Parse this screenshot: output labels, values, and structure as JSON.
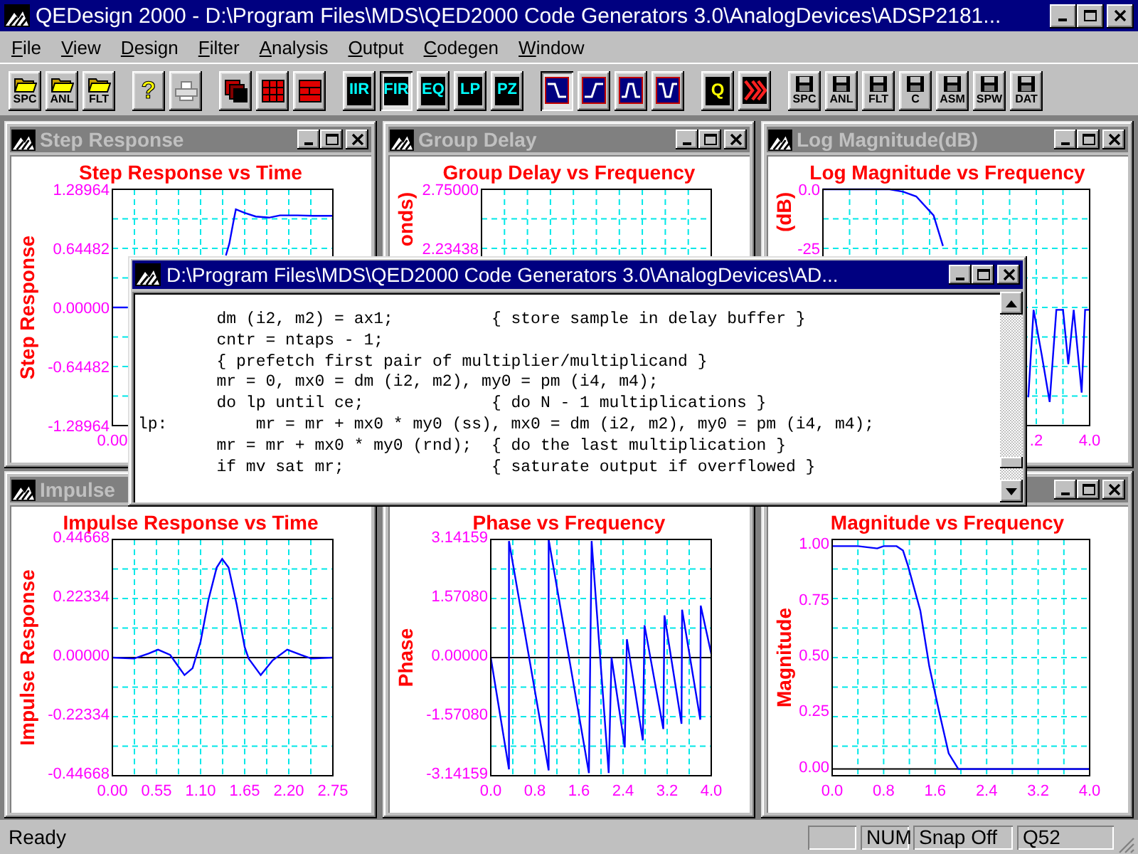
{
  "window": {
    "title": "QEDesign 2000 - D:\\Program Files\\MDS\\QED2000 Code Generators 3.0\\AnalogDevices\\ADSP2181..."
  },
  "menu": [
    "File",
    "View",
    "Design",
    "Filter",
    "Analysis",
    "Output",
    "Codegen",
    "Window"
  ],
  "toolbar": [
    [
      {
        "kind": "open",
        "label": "SPC"
      },
      {
        "kind": "open",
        "label": "ANL"
      },
      {
        "kind": "open",
        "label": "FLT"
      }
    ],
    [
      {
        "kind": "help",
        "label": "?"
      },
      {
        "kind": "print",
        "disabled": true
      }
    ],
    [
      {
        "kind": "cascade"
      },
      {
        "kind": "grid"
      },
      {
        "kind": "rows"
      }
    ],
    [
      {
        "kind": "mode",
        "label": "IIR",
        "selected": false
      },
      {
        "kind": "mode",
        "label": "FIR",
        "selected": true
      },
      {
        "kind": "mode",
        "label": "EQ",
        "selected": false
      },
      {
        "kind": "mode",
        "label": "LP",
        "selected": false
      },
      {
        "kind": "mode",
        "label": "PZ",
        "selected": false
      }
    ],
    [
      {
        "kind": "lowpass",
        "selected": true
      },
      {
        "kind": "highpass",
        "selected": false
      },
      {
        "kind": "bandpass",
        "selected": false
      },
      {
        "kind": "bandstop",
        "selected": false
      }
    ],
    [
      {
        "kind": "quantize",
        "label": "Q"
      },
      {
        "kind": "chevrons"
      }
    ],
    [
      {
        "kind": "save",
        "label": "SPC"
      },
      {
        "kind": "save",
        "label": "ANL"
      },
      {
        "kind": "save",
        "label": "FLT"
      },
      {
        "kind": "save",
        "label": "C"
      },
      {
        "kind": "save",
        "label": "ASM"
      },
      {
        "kind": "save",
        "label": "SPW"
      },
      {
        "kind": "save",
        "label": "DAT"
      }
    ]
  ],
  "child_windows": [
    {
      "title": "Step Response",
      "plot": {
        "kind": "step",
        "title": "Step Response vs Time",
        "ylabel": "Step Response",
        "grid": true,
        "ytick_labels": [
          "1.28964",
          "0.64482",
          "0.00000",
          "-0.64482",
          "-1.28964"
        ],
        "xtick_labels": [
          "0.00"
        ]
      }
    },
    {
      "title": "Group Delay",
      "plot": {
        "kind": "group_delay",
        "title": "Group Delay vs Frequency",
        "ylabel": "onds)",
        "grid": true,
        "ytick_labels": [
          "2.75000",
          "2.23438"
        ]
      }
    },
    {
      "title": "Log Magnitude(dB)",
      "plot": {
        "kind": "log_magnitude",
        "title": "Log Magnitude vs Frequency",
        "ylabel": "(dB)",
        "grid": true,
        "ytick_labels": [
          "0.0",
          "-25"
        ],
        "xtick_labels": [
          ".2",
          "4.0"
        ]
      }
    },
    {
      "title": "Impulse",
      "chart_data": {
        "type": "line",
        "title": "Impulse Response vs Time",
        "ylabel": "Impulse Response",
        "x": [
          0,
          0.27,
          0.45,
          0.57,
          0.72,
          0.9,
          1.0,
          1.1,
          1.2,
          1.3,
          1.37,
          1.45,
          1.55,
          1.65,
          1.7,
          1.85,
          2.0,
          2.18,
          2.35,
          2.48,
          2.75
        ],
        "series": [
          {
            "color": "#0000ff",
            "values": [
              0,
              -0.004,
              0.015,
              0.03,
              0.01,
              -0.066,
              -0.04,
              0.06,
              0.22,
              0.34,
              0.373,
              0.34,
              0.2,
              0.04,
              -0.004,
              -0.066,
              -0.01,
              0.03,
              0.01,
              -0.004,
              0
            ]
          }
        ],
        "xlim": [
          0,
          2.75
        ],
        "grid": true,
        "ylim": [
          -0.44668,
          0.44668
        ],
        "xticks": [
          {
            "value": 0,
            "label": "0.00"
          },
          {
            "value": 0.55,
            "label": "0.55"
          },
          {
            "value": 1.1,
            "label": "1.10"
          },
          {
            "value": 1.65,
            "label": "1.65"
          },
          {
            "value": 2.2,
            "label": "2.20"
          },
          {
            "value": 2.75,
            "label": "2.75"
          }
        ],
        "yticks": [
          {
            "value": 0.44668,
            "label": "0.44668"
          },
          {
            "value": 0.22334,
            "label": "0.22334"
          },
          {
            "value": 0,
            "label": "0.00000"
          },
          {
            "value": -0.22334,
            "label": "-0.22334"
          },
          {
            "value": -0.44668,
            "label": "-0.44668"
          }
        ]
      }
    },
    {
      "chart_data": {
        "type": "line",
        "title": "Phase vs Frequency",
        "ylabel": "Phase",
        "x": [
          0,
          0.33,
          0.33,
          1.05,
          1.05,
          1.78,
          1.83,
          2.14,
          2.19,
          2.43,
          2.47,
          2.76,
          2.79,
          3.13,
          3.15,
          3.46,
          3.47,
          3.8,
          3.81,
          4.0
        ],
        "series": [
          {
            "color": "#0000ff",
            "values": [
              0,
              -2.97,
              3.1,
              -3.0,
              3.14,
              -3.07,
              3.1,
              -3.07,
              0.0,
              -2.39,
              0.49,
              -2.2,
              0.86,
              -1.9,
              1.12,
              -1.76,
              1.27,
              -1.65,
              1.38,
              0.1
            ]
          }
        ],
        "xlim": [
          0,
          4
        ],
        "grid": true,
        "ylim": [
          -3.14159,
          3.14159
        ],
        "xticks": [
          {
            "value": 0,
            "label": "0.0"
          },
          {
            "value": 0.8,
            "label": "0.8"
          },
          {
            "value": 1.6,
            "label": "1.6"
          },
          {
            "value": 2.4,
            "label": "2.4"
          },
          {
            "value": 3.2,
            "label": "3.2"
          },
          {
            "value": 4,
            "label": "4.0"
          }
        ],
        "yticks": [
          {
            "value": 3.14159,
            "label": "3.14159"
          },
          {
            "value": 1.5708,
            "label": "1.57080"
          },
          {
            "value": 0,
            "label": "0.00000"
          },
          {
            "value": -1.5708,
            "label": "-1.57080"
          },
          {
            "value": -3.14159,
            "label": "-3.14159"
          }
        ]
      }
    },
    {
      "chart_data": {
        "type": "line",
        "title": "Magnitude vs Frequency",
        "ylabel": "Magnitude",
        "x": [
          0,
          0.4,
          0.7,
          0.8,
          1.0,
          1.1,
          1.18,
          1.37,
          1.51,
          1.66,
          1.81,
          1.96,
          2.1,
          4.0
        ],
        "series": [
          {
            "color": "#0000ff",
            "values": [
              1,
              1,
              0.99,
              1,
              1,
              0.98,
              0.91,
              0.71,
              0.46,
              0.26,
              0.07,
              0,
              0,
              0
            ]
          }
        ],
        "xlim": [
          0,
          4
        ],
        "grid": true,
        "ylim": [
          -0.03,
          1.03
        ],
        "xticks": [
          {
            "value": 0,
            "label": "0.0"
          },
          {
            "value": 0.8,
            "label": "0.8"
          },
          {
            "value": 1.6,
            "label": "1.6"
          },
          {
            "value": 2.4,
            "label": "2.4"
          },
          {
            "value": 3.2,
            "label": "3.2"
          },
          {
            "value": 4,
            "label": "4.0"
          }
        ],
        "yticks": [
          {
            "value": 1,
            "label": "1.00"
          },
          {
            "value": 0.75,
            "label": "0.75"
          },
          {
            "value": 0.5,
            "label": "0.50"
          },
          {
            "value": 0.25,
            "label": "0.25"
          },
          {
            "value": 0,
            "label": "0.00"
          }
        ]
      }
    }
  ],
  "code_window": {
    "title": "D:\\Program Files\\MDS\\QED2000 Code Generators 3.0\\AnalogDevices\\AD...",
    "lines": [
      "        dm (i2, m2) = ax1;          { store sample in delay buffer }",
      "        cntr = ntaps - 1;",
      "        { prefetch first pair of multiplier/multiplicand }",
      "        mr = 0, mx0 = dm (i2, m2), my0 = pm (i4, m4);",
      "        do lp until ce;             { do N - 1 multiplications }",
      "lp:         mr = mr + mx0 * my0 (ss), mx0 = dm (i2, m2), my0 = pm (i4, m4);",
      "        mr = mr + mx0 * my0 (rnd);  { do the last multiplication }",
      "        if mv sat mr;               { saturate output if overflowed }"
    ]
  },
  "status_bar": {
    "message": "Ready",
    "panels": [
      "NUM",
      "Snap Off",
      "Q52"
    ]
  }
}
